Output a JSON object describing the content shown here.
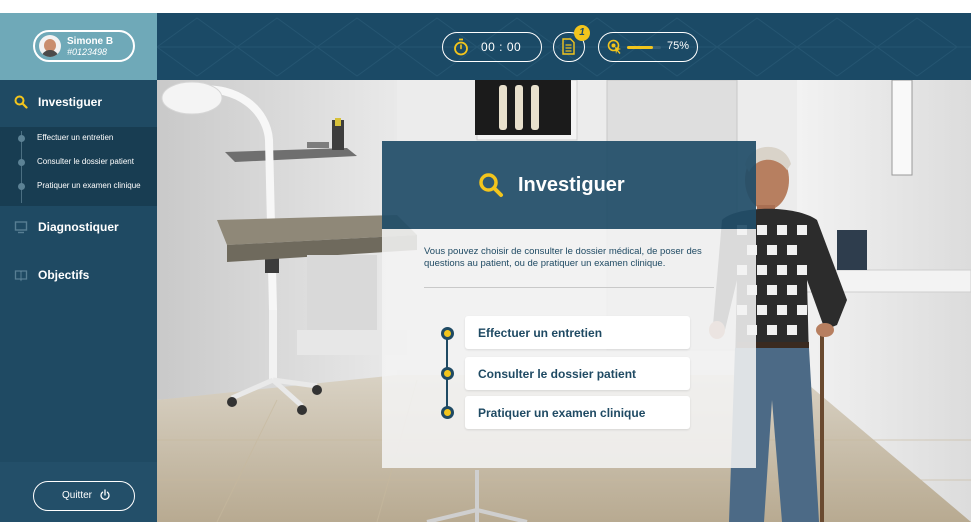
{
  "user": {
    "name": "Simone B",
    "id": "#0123498"
  },
  "sidebar": {
    "items": [
      {
        "label": "Investiguer",
        "icon": "search-icon",
        "active": true
      },
      {
        "label": "Diagnostiquer",
        "icon": "monitor-icon",
        "active": false
      },
      {
        "label": "Objectifs",
        "icon": "book-icon",
        "active": false
      }
    ],
    "subitems": [
      {
        "label": "Effectuer un entretien"
      },
      {
        "label": "Consulter le dossier patient"
      },
      {
        "label": "Pratiquer un examen clinique"
      }
    ],
    "quit_label": "Quitter"
  },
  "topbar": {
    "timer": "00 : 00",
    "notification_count": "1",
    "progress_text": "75%",
    "progress_fraction": 0.75
  },
  "card": {
    "title": "Investiguer",
    "description": "Vous pouvez choisir de consulter le dossier médical, de poser des questions au patient, ou de pratiquer un examen clinique.",
    "options": [
      {
        "label": "Effectuer un entretien"
      },
      {
        "label": "Consulter le dossier patient"
      },
      {
        "label": "Pratiquer un examen clinique"
      }
    ]
  },
  "colors": {
    "sidebar": "#1f4a63",
    "topbar": "#1b4a66",
    "user_box": "#6fa9b8",
    "accent": "#f3c51c"
  }
}
